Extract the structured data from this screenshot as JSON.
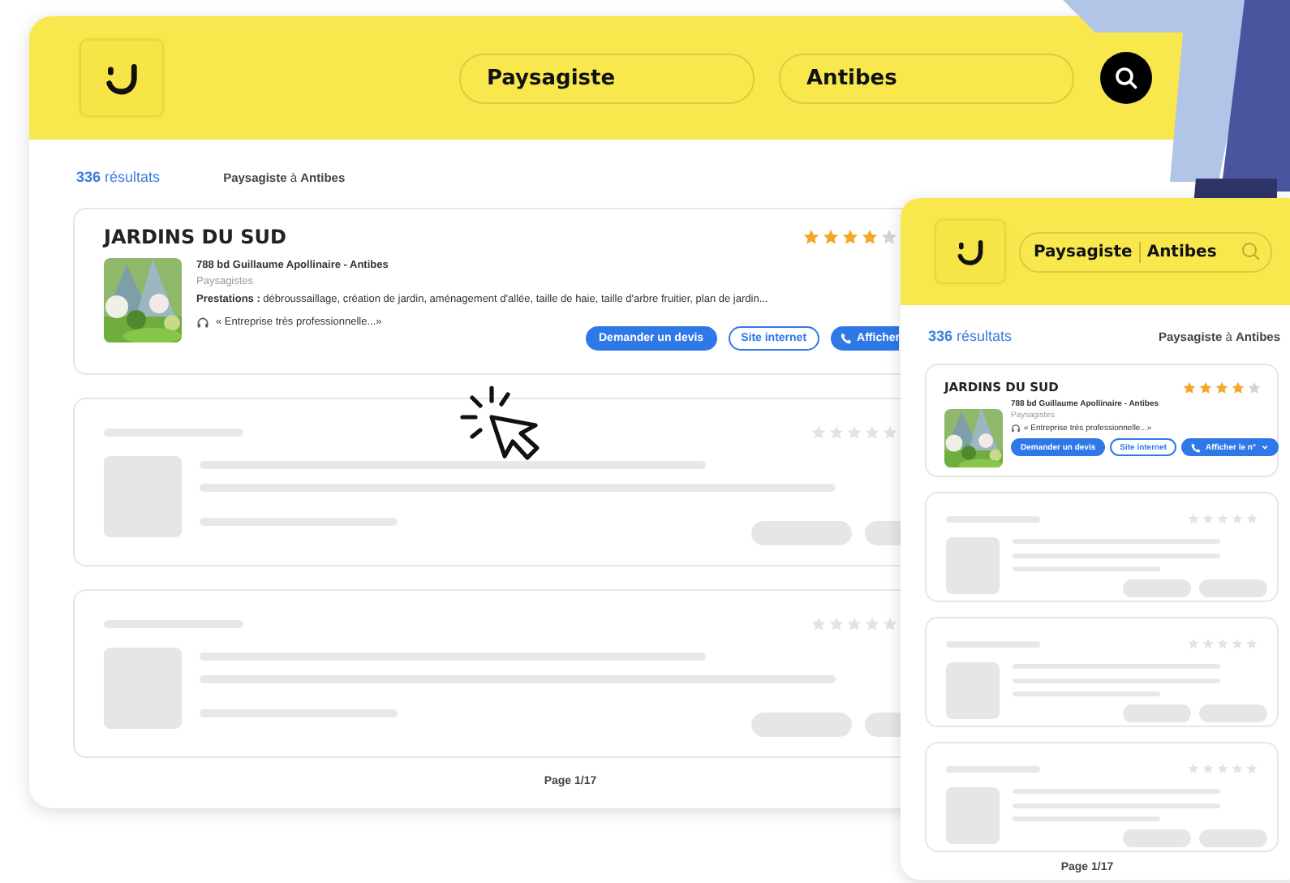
{
  "desktop": {
    "search_fields": [
      {
        "value": "Paysagiste"
      },
      {
        "value": "Antibes"
      }
    ],
    "results": {
      "count": "336",
      "label": "résultats"
    },
    "query": "**Paysagiste** à **Antibes**",
    "listing": {
      "name": "JARDINS DU SUD",
      "stars": 4,
      "address": "788 bd Guillaume Apollinaire - Antibes",
      "category": "Paysagistes",
      "services": "**Prestations :** débroussaillage, création de jardin, aménagement d'allée, taille de haie, taille d'arbre fruitier, plan de jardin...",
      "review": "« Entreprise très professionnelle...»",
      "buttons": [
        {
          "label": "Demander un devis",
          "kind": "primary"
        },
        {
          "label": "Site internet",
          "kind": "outline"
        },
        {
          "label": "Afficher",
          "kind": "phone"
        }
      ]
    },
    "placeholder_cards": [
      {
        "kind": "skeleton"
      },
      {
        "kind": "skeleton"
      }
    ],
    "pagination": "Page 1/17"
  },
  "mobile": {
    "search_fields": [
      {
        "value": "Paysagiste"
      },
      {
        "value": "Antibes"
      }
    ],
    "results": {
      "count": "336",
      "label": "résultats"
    },
    "query": "**Paysagiste** à **Antibes**",
    "listing": {
      "name": "JARDINS DU SUD",
      "stars": 4,
      "address": "788 bd Guillaume Apollinaire - Antibes",
      "category": "Paysagistes",
      "review": "« Entreprise très professionnelle...»",
      "buttons": [
        {
          "label": "Demander un devis",
          "kind": "primary"
        },
        {
          "label": "Site internet",
          "kind": "outline"
        },
        {
          "label": "Afficher le n°",
          "kind": "phone-menu"
        }
      ]
    },
    "placeholder_cards": [
      {
        "kind": "skeleton"
      },
      {
        "kind": "skeleton"
      },
      {
        "kind": "skeleton"
      }
    ],
    "pagination": "Page 1/17"
  }
}
